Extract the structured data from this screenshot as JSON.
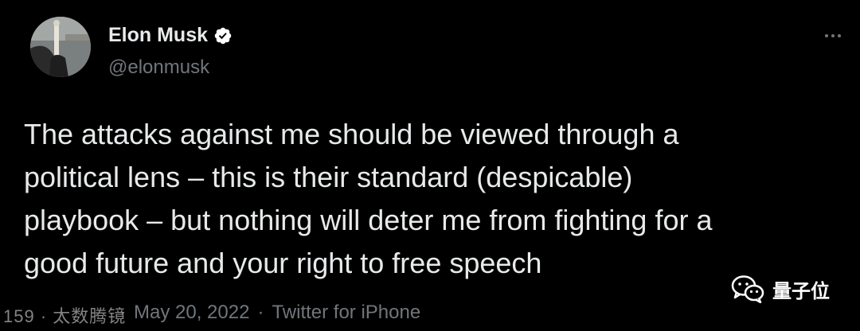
{
  "author": {
    "name": "Elon Musk",
    "handle": "@elonmusk",
    "verified": true
  },
  "tweet": {
    "lines": [
      "The attacks against me should be viewed through a",
      "political lens – this is their standard (despicable)",
      "playbook – but nothing will deter me from fighting for a",
      "good future and your right to free speech"
    ]
  },
  "meta": {
    "time_overlay": "159 · 太数腾镜",
    "separator": "·",
    "date": "May 20, 2022",
    "source": "Twitter for iPhone"
  },
  "watermark": {
    "text": "量子位"
  },
  "colors": {
    "background": "#000000",
    "text": "#e7e9ea",
    "secondary": "#71767b",
    "verified": "#ffffff"
  },
  "icons": {
    "verified": "verified-badge-icon",
    "more": "more-options-icon",
    "watermark": "wechat-logo-icon"
  }
}
